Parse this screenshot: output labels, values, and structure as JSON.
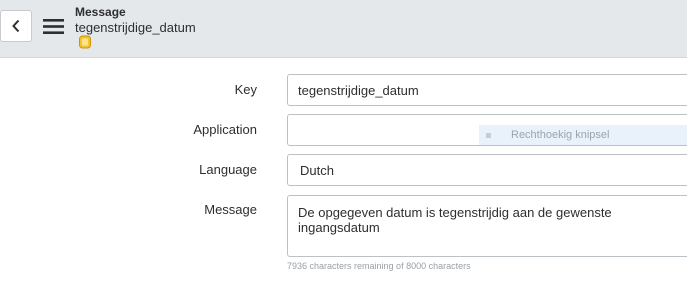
{
  "header": {
    "kind": "Message",
    "name": "tegenstrijdige_datum",
    "back_icon": "chevron-left-icon",
    "menu_icon": "hamburger-menu-icon",
    "record_icon": "record-badge-icon"
  },
  "form": {
    "key": {
      "label": "Key",
      "value": "tegenstrijdige_datum"
    },
    "application": {
      "label": "Application",
      "value": ""
    },
    "language": {
      "label": "Language",
      "value": "Dutch"
    },
    "message": {
      "label": "Message",
      "value": "De opgegeven datum is tegenstrijdig aan de gewenste ingangsdatum",
      "char_counter": "7936 characters remaining of 8000 characters"
    }
  },
  "overlay": {
    "snip_label": "Rechthoekig knipsel"
  },
  "colors": {
    "header_bg": "#e5e8eb",
    "field_border": "#bcc1c6",
    "badge": "#f4c430"
  }
}
